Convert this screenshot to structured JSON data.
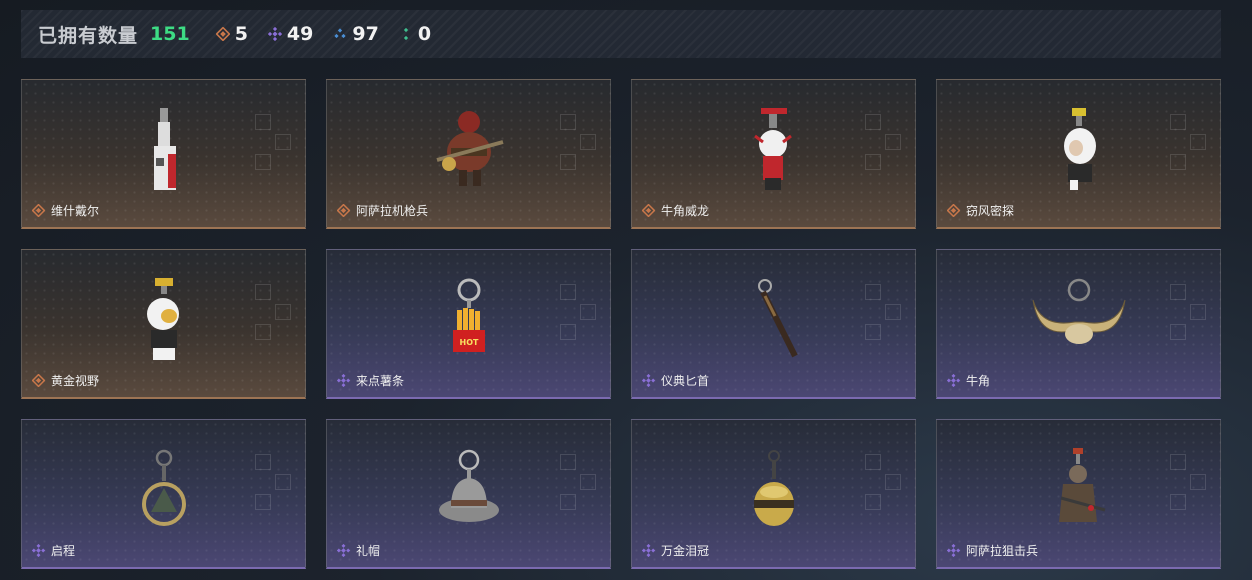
{
  "header": {
    "title": "已拥有数量",
    "total": "151",
    "stats": [
      {
        "icon": "orange-diamond-icon",
        "color": "#c8774a",
        "value": "5"
      },
      {
        "icon": "purple-diamond-icon",
        "color": "#8a6fd6",
        "value": "49"
      },
      {
        "icon": "blue-diamond-icon",
        "color": "#4a8fd6",
        "value": "97"
      },
      {
        "icon": "green-diamond-icon",
        "color": "#3fbf8f",
        "value": "0"
      }
    ]
  },
  "items": [
    {
      "name": "维什戴尔",
      "rarity": "orange",
      "icon": "pendant-figure-icon"
    },
    {
      "name": "阿萨拉机枪兵",
      "rarity": "orange",
      "icon": "armored-soldier-icon"
    },
    {
      "name": "牛角威龙",
      "rarity": "orange",
      "icon": "horned-figure-icon"
    },
    {
      "name": "窃风密探",
      "rarity": "orange",
      "icon": "white-haired-figure-icon"
    },
    {
      "name": "黄金视野",
      "rarity": "orange",
      "icon": "golden-figure-icon"
    },
    {
      "name": "来点薯条",
      "rarity": "purple",
      "icon": "fries-keychain-icon"
    },
    {
      "name": "仪典匕首",
      "rarity": "purple",
      "icon": "dagger-icon"
    },
    {
      "name": "牛角",
      "rarity": "purple",
      "icon": "bull-horns-icon"
    },
    {
      "name": "启程",
      "rarity": "purple",
      "icon": "medallion-icon"
    },
    {
      "name": "礼帽",
      "rarity": "purple",
      "icon": "fedora-hat-icon"
    },
    {
      "name": "万金泪冠",
      "rarity": "purple",
      "icon": "golden-orb-icon"
    },
    {
      "name": "阿萨拉狙击兵",
      "rarity": "purple",
      "icon": "sniper-figure-icon"
    }
  ]
}
